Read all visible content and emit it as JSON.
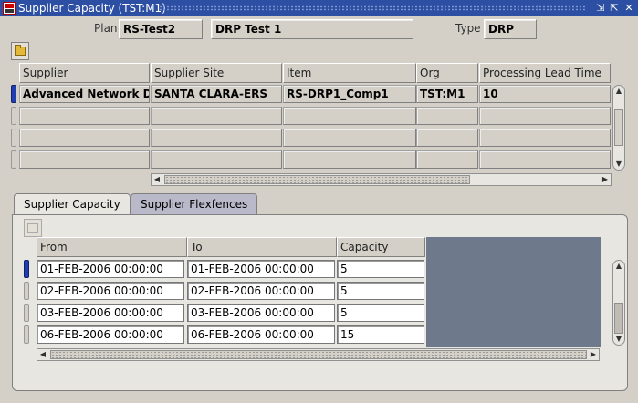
{
  "window": {
    "title": "Supplier Capacity (TST:M1)",
    "controls": {
      "minimize": "⇲",
      "maximize": "⇱",
      "close": "✕"
    }
  },
  "header": {
    "plan_label": "Plan",
    "plan_value": "RS-Test2",
    "plan_desc": "DRP Test 1",
    "type_label": "Type",
    "type_value": "DRP"
  },
  "grid": {
    "columns": [
      "Supplier",
      "Supplier Site",
      "Item",
      "Org",
      "Processing Lead Time"
    ],
    "rows": [
      [
        "Advanced Network De",
        "SANTA CLARA-ERS",
        "RS-DRP1_Comp1",
        "TST:M1",
        "10"
      ],
      [
        "",
        "",
        "",
        "",
        ""
      ],
      [
        "",
        "",
        "",
        "",
        ""
      ],
      [
        "",
        "",
        "",
        "",
        ""
      ]
    ]
  },
  "tabs": [
    {
      "label": "Supplier Capacity",
      "active": true
    },
    {
      "label": "Supplier Flexfences",
      "active": false
    }
  ],
  "capacity": {
    "columns": [
      "From",
      "To",
      "Capacity"
    ],
    "rows": [
      [
        "01-FEB-2006 00:00:00",
        "01-FEB-2006 00:00:00",
        "5"
      ],
      [
        "02-FEB-2006 00:00:00",
        "02-FEB-2006 00:00:00",
        "5"
      ],
      [
        "03-FEB-2006 00:00:00",
        "03-FEB-2006 00:00:00",
        "5"
      ],
      [
        "06-FEB-2006 00:00:00",
        "06-FEB-2006 00:00:00",
        "15"
      ]
    ]
  },
  "colors": {
    "titlebar": "#2c4fa3",
    "active_indicator": "#1f3fb0",
    "background": "#d4d0c8"
  }
}
